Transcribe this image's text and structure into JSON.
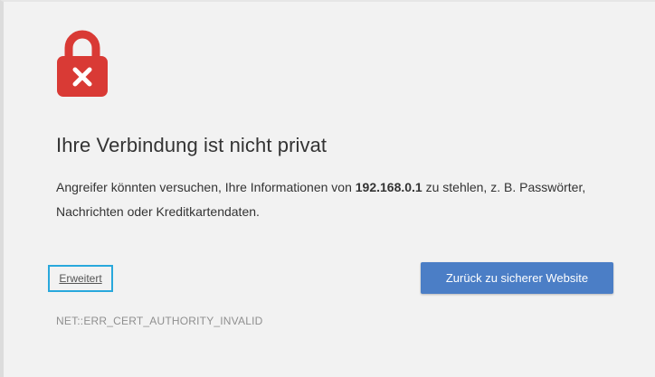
{
  "interstitial": {
    "title": "Ihre Verbindung ist nicht privat",
    "message_before": "Angreifer könnten versuchen, Ihre Informationen von ",
    "host": "192.168.0.1",
    "message_after": " zu stehlen, z. B. Passwörter, Nachrichten oder Kreditkartendaten.",
    "advanced_label": "Erweitert",
    "back_button_label": "Zurück zu sicherer Website",
    "error_code": "NET::ERR_CERT_AUTHORITY_INVALID"
  },
  "icons": {
    "lock": "lock-error-icon"
  },
  "colors": {
    "lock_red": "#d93a35",
    "button_blue": "#4b7ec6",
    "highlight_border": "#29a8dc",
    "background": "#f2f2f2"
  }
}
